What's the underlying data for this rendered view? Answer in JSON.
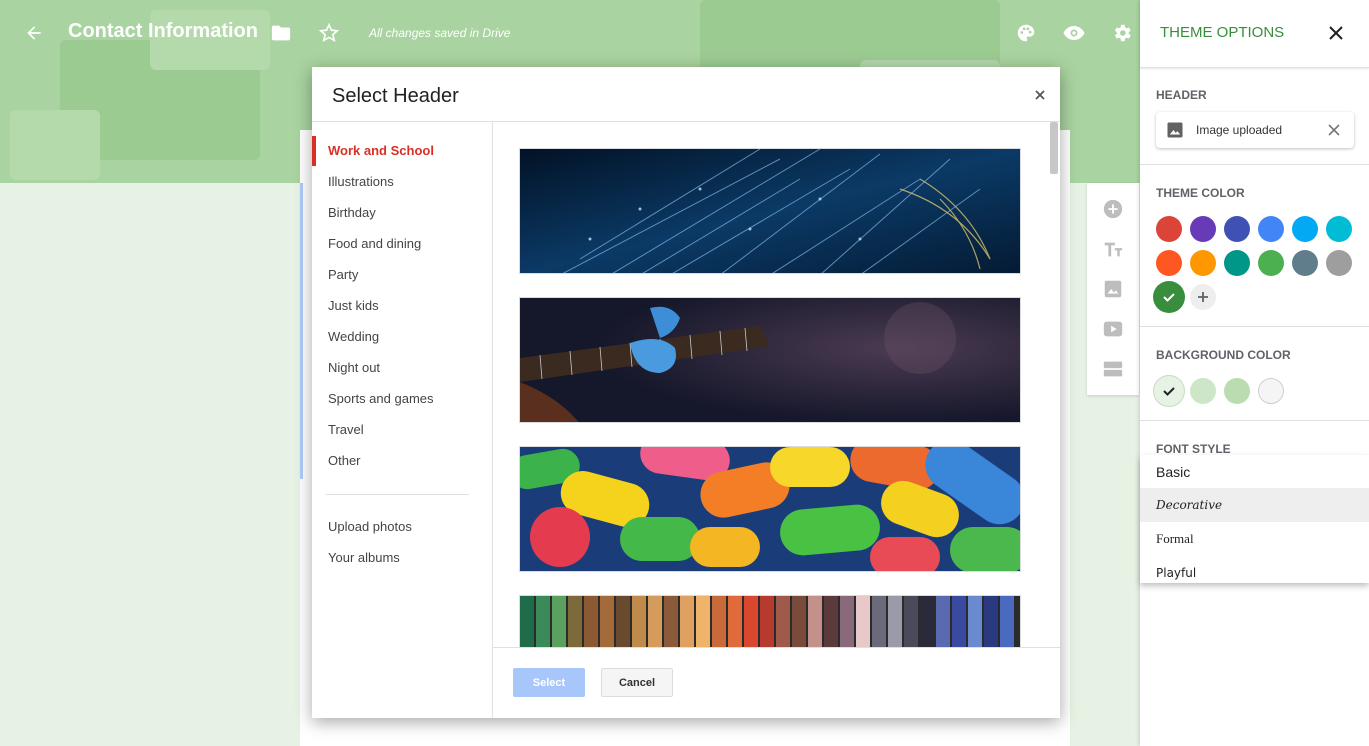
{
  "topbar": {
    "title": "Contact Information",
    "saved_status": "All changes saved in Drive",
    "icons": [
      "back-arrow-icon",
      "folder-icon",
      "star-icon",
      "palette-icon",
      "eye-icon",
      "gear-icon"
    ]
  },
  "side_tools": [
    "add-question-icon",
    "title-text-icon",
    "image-icon",
    "video-icon",
    "section-icon"
  ],
  "modal": {
    "title": "Select Header",
    "categories": [
      {
        "label": "Work and School",
        "active": true
      },
      {
        "label": "Illustrations"
      },
      {
        "label": "Birthday"
      },
      {
        "label": "Food and dining"
      },
      {
        "label": "Party"
      },
      {
        "label": "Just kids"
      },
      {
        "label": "Wedding"
      },
      {
        "label": "Night out"
      },
      {
        "label": "Sports and games"
      },
      {
        "label": "Travel"
      },
      {
        "label": "Other"
      }
    ],
    "extra_links": [
      "Upload photos",
      "Your albums"
    ],
    "thumbnails": [
      "fiber-optic-lights",
      "guitar-player",
      "colorful-candy",
      "colored-pencils-yarn"
    ],
    "select_label": "Select",
    "cancel_label": "Cancel"
  },
  "panel": {
    "title": "THEME OPTIONS",
    "header_label": "HEADER",
    "header_chip": "Image uploaded",
    "theme_color_label": "THEME COLOR",
    "theme_colors": [
      "#db4437",
      "#673ab7",
      "#3f51b5",
      "#4285f4",
      "#03a9f4",
      "#00bcd4",
      "#ff5722",
      "#ff9800",
      "#009688",
      "#4caf50",
      "#607d8b",
      "#9e9e9e",
      "#388e3c"
    ],
    "selected_theme_color": "#388e3c",
    "background_color_label": "BACKGROUND COLOR",
    "background_colors": [
      "#e6f2e3",
      "#cde6c8",
      "#b9dcb1",
      "#f5f5f5"
    ],
    "font_style_label": "FONT STYLE",
    "font_options": [
      "Basic",
      "Decorative",
      "Formal",
      "Playful"
    ],
    "highlighted_font": "Decorative"
  }
}
